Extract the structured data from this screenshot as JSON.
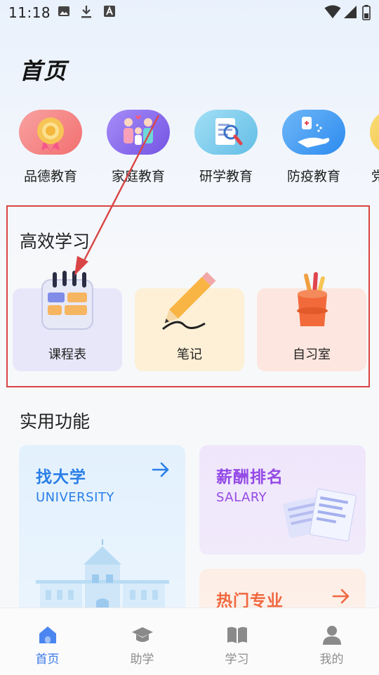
{
  "status_bar": {
    "time": "11:18"
  },
  "page_title": "首页",
  "categories": [
    {
      "label": "品德教育",
      "color": "#f47a7a"
    },
    {
      "label": "家庭教育",
      "color": "#8a6cf0"
    },
    {
      "label": "研学教育",
      "color": "#6cc3ea"
    },
    {
      "label": "防疫教育",
      "color": "#3f9df3"
    },
    {
      "label": "党",
      "color": "#f5c84a"
    }
  ],
  "study": {
    "title": "高效学习",
    "items": [
      {
        "label": "课程表",
        "bg": "#e9e8fa"
      },
      {
        "label": "笔记",
        "bg": "#fdf0d6"
      },
      {
        "label": "自习室",
        "bg": "#fde6df"
      }
    ]
  },
  "practical": {
    "title": "实用功能",
    "university": {
      "title": "找大学",
      "subtitle": "UNIVERSITY",
      "color": "#2a7ee8"
    },
    "salary": {
      "title": "薪酬排名",
      "subtitle": "SALARY",
      "color": "#9449e6"
    },
    "hot_major": {
      "title": "热门专业",
      "color": "#f0673f"
    }
  },
  "nav": [
    {
      "label": "首页",
      "icon": "home-icon",
      "active": true
    },
    {
      "label": "助学",
      "icon": "graduation-cap-icon",
      "active": false
    },
    {
      "label": "学习",
      "icon": "book-icon",
      "active": false
    },
    {
      "label": "我的",
      "icon": "person-icon",
      "active": false
    }
  ],
  "accent_color": "#3a78e8",
  "annotation_color": "#d94545"
}
